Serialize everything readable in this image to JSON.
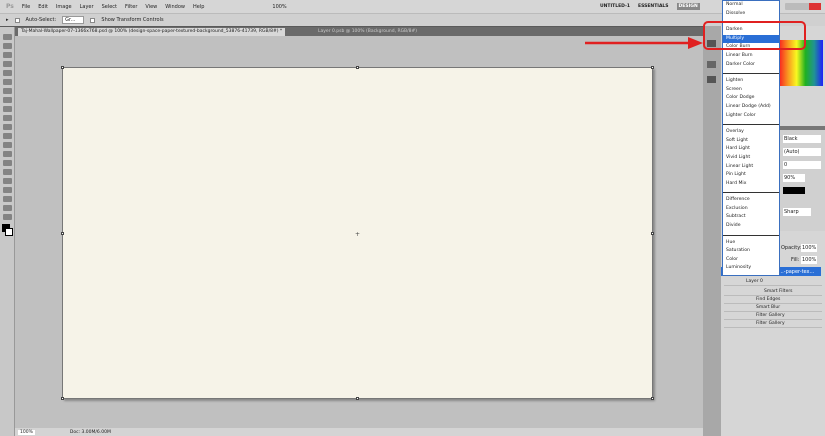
{
  "app": {
    "logo": "Ps",
    "menu": [
      "File",
      "Edit",
      "Image",
      "Layer",
      "Select",
      "Filter",
      "View",
      "Window",
      "Help"
    ],
    "zoom_select": "100%"
  },
  "workspaces": [
    "UNTITLED-1",
    "ESSENTIALS",
    "DESIGN"
  ],
  "options": {
    "auto_select": "Auto-Select:",
    "auto_select_target": "Gr...",
    "show_transform": "Show Transform Controls"
  },
  "tabs": [
    {
      "label": "Taj-Mahal-Wallpaper-07-1366x768.psd @ 100% (design-space-paper-textured-background_53876-41739, RGB/8#) *",
      "active": true
    },
    {
      "label": "Layer 0.psb @ 100% (Background, RGB/8#)",
      "active": false
    }
  ],
  "status": {
    "zoom": "100%",
    "doc": "Doc: 3.00M/6.00M"
  },
  "blend_modes": {
    "groups": [
      [
        "Normal",
        "Dissolve"
      ],
      [
        "Darken",
        "Multiply",
        "Color Burn",
        "Linear Burn",
        "Darker Color"
      ],
      [
        "Lighten",
        "Screen",
        "Color Dodge",
        "Linear Dodge (Add)",
        "Lighter Color"
      ],
      [
        "Overlay",
        "Soft Light",
        "Hard Light",
        "Vivid Light",
        "Linear Light",
        "Pin Light",
        "Hard Mix"
      ],
      [
        "Difference",
        "Exclusion",
        "Subtract",
        "Divide"
      ],
      [
        "Hue",
        "Saturation",
        "Color",
        "Luminosity"
      ]
    ],
    "selected": "Multiply"
  },
  "char_panel": {
    "color": "Black",
    "leading": "(Auto)",
    "tracking": "0",
    "scale": "90%",
    "aa": "Sharp"
  },
  "layers_panel": {
    "opacity_label": "Opacity:",
    "opacity": "100%",
    "fill_label": "Fill:",
    "fill": "100%",
    "selected_layer": "...-paper-tex...",
    "layer": "Layer 0",
    "smart_filters": "Smart Filters",
    "filters": [
      "Find Edges",
      "Smart Blur",
      "Filter Gallery",
      "Filter Gallery"
    ]
  },
  "colors": {
    "highlight": "#2a6fd6",
    "annotation": "#e02020"
  }
}
